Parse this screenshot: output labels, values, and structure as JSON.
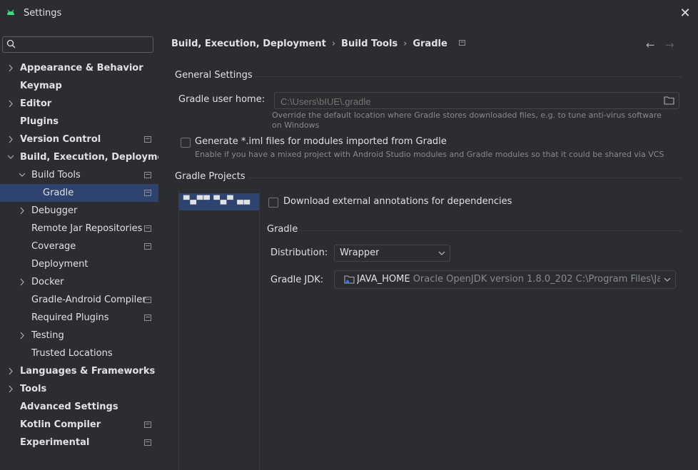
{
  "window": {
    "title": "Settings",
    "close_glyph": "✕"
  },
  "search": {
    "placeholder": "",
    "value": ""
  },
  "sidebar": {
    "items": [
      {
        "label": "Appearance & Behavior",
        "level": 0,
        "expandable": true,
        "expanded": false,
        "bold": true,
        "page_mark": false
      },
      {
        "label": "Keymap",
        "level": 0,
        "expandable": false,
        "bold": true,
        "page_mark": false
      },
      {
        "label": "Editor",
        "level": 0,
        "expandable": true,
        "expanded": false,
        "bold": true,
        "page_mark": false
      },
      {
        "label": "Plugins",
        "level": 0,
        "expandable": false,
        "bold": true,
        "page_mark": false
      },
      {
        "label": "Version Control",
        "level": 0,
        "expandable": true,
        "expanded": false,
        "bold": true,
        "page_mark": true
      },
      {
        "label": "Build, Execution, Deployment",
        "level": 0,
        "expandable": true,
        "expanded": true,
        "bold": true,
        "page_mark": false
      },
      {
        "label": "Build Tools",
        "level": 1,
        "expandable": true,
        "expanded": true,
        "bold": false,
        "page_mark": true
      },
      {
        "label": "Gradle",
        "level": 2,
        "expandable": false,
        "bold": false,
        "page_mark": true,
        "selected": true
      },
      {
        "label": "Debugger",
        "level": 1,
        "expandable": true,
        "expanded": false,
        "bold": false,
        "page_mark": false
      },
      {
        "label": "Remote Jar Repositories",
        "level": 1,
        "expandable": false,
        "bold": false,
        "page_mark": true
      },
      {
        "label": "Coverage",
        "level": 1,
        "expandable": false,
        "bold": false,
        "page_mark": true
      },
      {
        "label": "Deployment",
        "level": 1,
        "expandable": false,
        "bold": false,
        "page_mark": false
      },
      {
        "label": "Docker",
        "level": 1,
        "expandable": true,
        "expanded": false,
        "bold": false,
        "page_mark": false
      },
      {
        "label": "Gradle-Android Compiler",
        "level": 1,
        "expandable": false,
        "bold": false,
        "page_mark": true
      },
      {
        "label": "Required Plugins",
        "level": 1,
        "expandable": false,
        "bold": false,
        "page_mark": true
      },
      {
        "label": "Testing",
        "level": 1,
        "expandable": true,
        "expanded": false,
        "bold": false,
        "page_mark": false
      },
      {
        "label": "Trusted Locations",
        "level": 1,
        "expandable": false,
        "bold": false,
        "page_mark": false
      },
      {
        "label": "Languages & Frameworks",
        "level": 0,
        "expandable": true,
        "expanded": false,
        "bold": true,
        "page_mark": false
      },
      {
        "label": "Tools",
        "level": 0,
        "expandable": true,
        "expanded": false,
        "bold": true,
        "page_mark": false
      },
      {
        "label": "Advanced Settings",
        "level": 0,
        "expandable": false,
        "bold": true,
        "page_mark": false
      },
      {
        "label": "Kotlin Compiler",
        "level": 0,
        "expandable": false,
        "bold": true,
        "page_mark": true
      },
      {
        "label": "Experimental",
        "level": 0,
        "expandable": false,
        "bold": true,
        "page_mark": true
      }
    ]
  },
  "breadcrumb": {
    "parts": [
      "Build, Execution, Deployment",
      "Build Tools",
      "Gradle"
    ],
    "separator": "›",
    "back_glyph": "←",
    "forward_glyph": "→"
  },
  "general": {
    "title": "General Settings",
    "user_home_label": "Gradle user home:",
    "user_home_placeholder": "C:\\Users\\bIUE\\.gradle",
    "user_home_hint": "Override the default location where Gradle stores downloaded files, e.g. to tune anti-virus software on Windows",
    "generate_iml_label": "Generate *.iml files for modules imported from Gradle",
    "generate_iml_checked": false,
    "generate_iml_hint": "Enable if you have a mixed project with Android Studio modules and Gradle modules so that it could be shared via VCS"
  },
  "projects": {
    "title": "Gradle Projects",
    "selected_project": "▀▄▀▀ ▀▄▀ ▄▄",
    "download_annotations_label": "Download external annotations for dependencies",
    "download_annotations_checked": false,
    "gradle_section_title": "Gradle",
    "distribution_label": "Distribution:",
    "distribution_value": "Wrapper",
    "jdk_label": "Gradle JDK:",
    "jdk_name": "JAVA_HOME",
    "jdk_detail": "Oracle OpenJDK version 1.8.0_202 C:\\Program Files\\Ja"
  },
  "colors": {
    "background": "#2b2d30",
    "selection": "#2e436e",
    "text": "#dfe1e5",
    "muted": "#868a91",
    "android_green": "#3ddc84"
  },
  "icons": {
    "app": "android-icon",
    "search": "search-icon",
    "folder": "folder-icon",
    "page_mark": "page-settings-icon",
    "jdk": "jdk-folder-icon"
  }
}
